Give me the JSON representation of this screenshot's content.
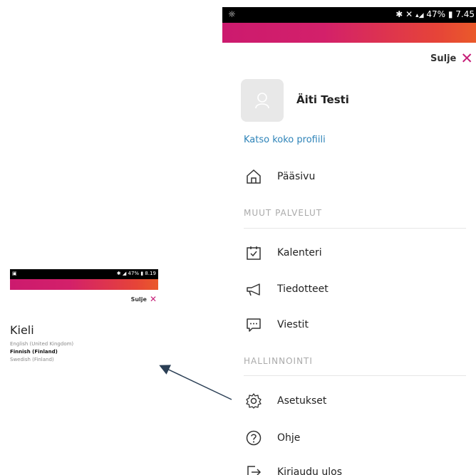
{
  "colors": {
    "accent": "#c61f78",
    "link": "#2d83b8",
    "gradient_start": "#cc1a6e",
    "gradient_end": "#ea5a2a",
    "arrow": "#2b3f55"
  },
  "main_screen": {
    "status_bar": {
      "right_text": "47%",
      "time": "7.45"
    },
    "close_label": "Sulje",
    "user_name": "Äiti Testi",
    "profile_link": "Katso koko profiili",
    "home_item": {
      "label": "Pääsivu",
      "icon": "home-icon"
    },
    "section_other": "MUUT PALVELUT",
    "other_items": [
      {
        "label": "Kalenteri",
        "icon": "calendar-icon"
      },
      {
        "label": "Tiedotteet",
        "icon": "megaphone-icon"
      },
      {
        "label": "Viestit",
        "icon": "message-icon"
      }
    ],
    "section_admin": "HALLINNOINTI",
    "admin_items": [
      {
        "label": "Asetukset",
        "icon": "gear-icon"
      },
      {
        "label": "Ohje",
        "icon": "help-icon"
      },
      {
        "label": "Kirjaudu ulos",
        "icon": "logout-icon"
      }
    ]
  },
  "language_screen": {
    "status_bar": {
      "right_text": "47%",
      "time": "8.19"
    },
    "close_label": "Sulje",
    "title": "Kieli",
    "options": [
      {
        "label": "English (United Kingdom)",
        "selected": false
      },
      {
        "label": "Finnish (Finland)",
        "selected": true
      },
      {
        "label": "Swedish (Finland)",
        "selected": false
      }
    ]
  }
}
